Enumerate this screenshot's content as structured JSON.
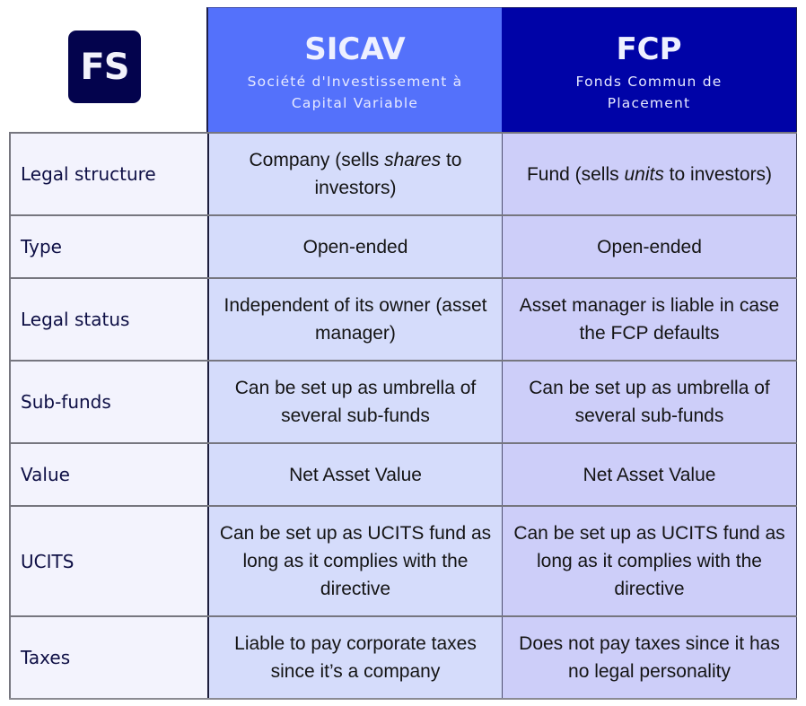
{
  "logo": {
    "text": "FS"
  },
  "columns": [
    {
      "title": "SICAV",
      "subtitle_line1": "Société d'Investissement à",
      "subtitle_line2": "Capital Variable",
      "color": "#5471fb"
    },
    {
      "title": "FCP",
      "subtitle_line1": "Fonds Commun de",
      "subtitle_line2": "Placement",
      "color": "#0003a7"
    }
  ],
  "rows": [
    {
      "label": "Legal structure",
      "sicav": {
        "pre": "Company (sells ",
        "em": "shares",
        "post": " to investors)"
      },
      "fcp": {
        "pre": "Fund (sells ",
        "em": "units",
        "post": " to investors)"
      }
    },
    {
      "label": "Type",
      "sicav": {
        "text": "Open-ended"
      },
      "fcp": {
        "text": "Open-ended"
      }
    },
    {
      "label": "Legal status",
      "sicav": {
        "text": "Independent of its owner (asset manager)"
      },
      "fcp": {
        "text": "Asset manager is liable in case the FCP defaults"
      }
    },
    {
      "label": "Sub-funds",
      "sicav": {
        "text": "Can be set up as umbrella of several sub-funds"
      },
      "fcp": {
        "text": "Can be set up as umbrella of several sub-funds"
      }
    },
    {
      "label": "Value",
      "sicav": {
        "text": "Net Asset Value"
      },
      "fcp": {
        "text": "Net Asset Value"
      }
    },
    {
      "label": "UCITS",
      "sicav": {
        "text": "Can be set up as UCITS fund as long as it complies with the directive"
      },
      "fcp": {
        "text": "Can be set up as UCITS fund as long as it complies with the directive"
      }
    },
    {
      "label": "Taxes",
      "sicav": {
        "text": "Liable to pay corporate taxes since it’s a company"
      },
      "fcp": {
        "text": "Does not pay taxes since it has no legal personality"
      }
    }
  ]
}
